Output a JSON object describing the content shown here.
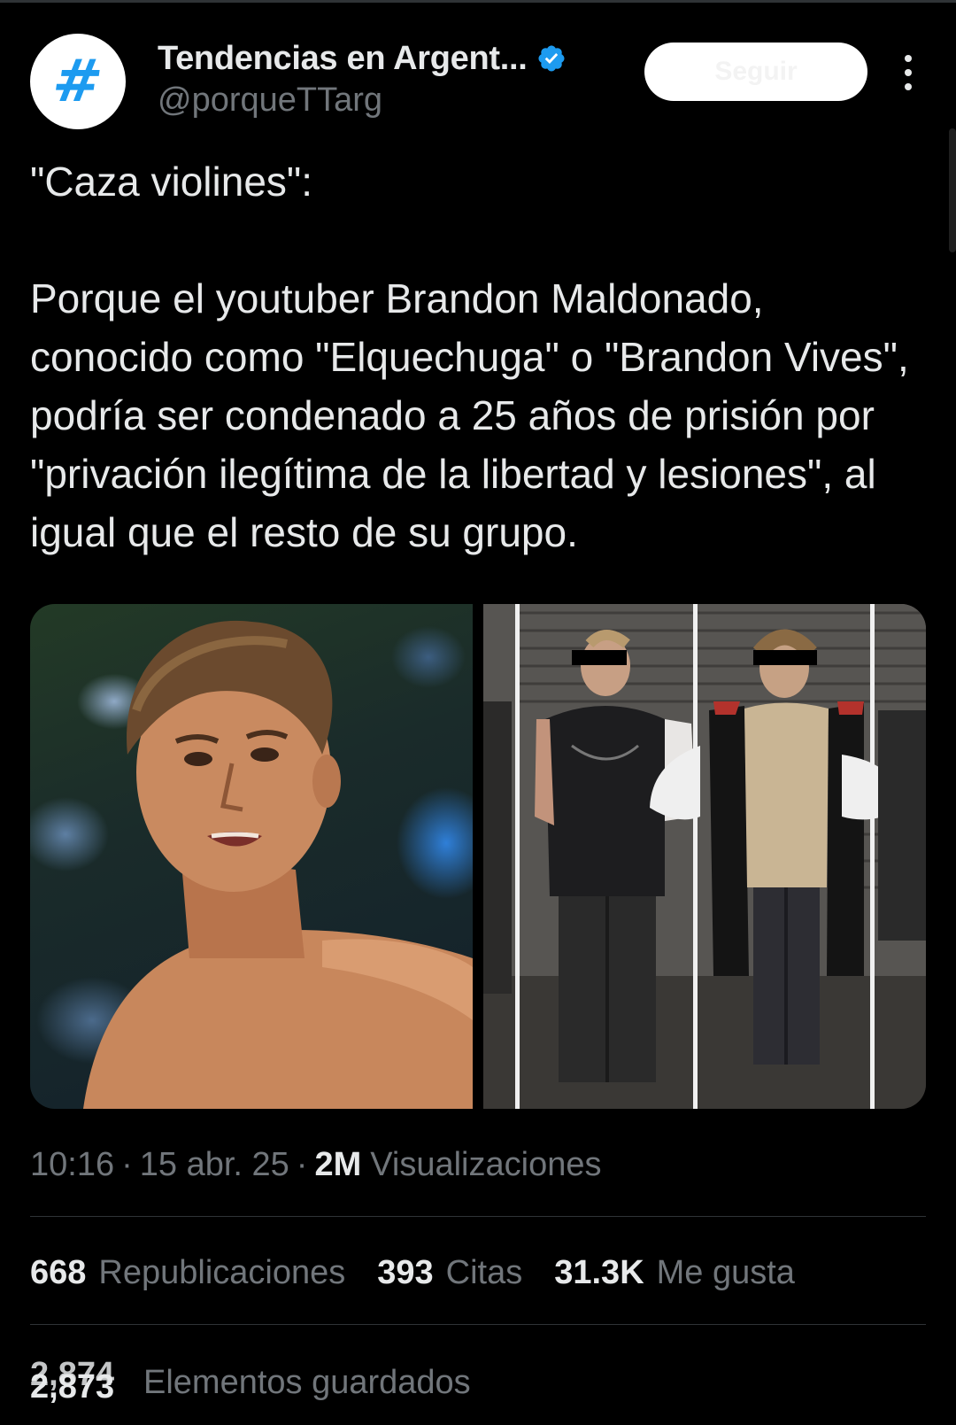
{
  "account": {
    "display_name": "Tendencias en Argent...",
    "handle": "@porqueTTarg",
    "avatar_glyph": "#",
    "verified_icon": "verified-badge-icon",
    "verified_color": "#1d9bf0"
  },
  "follow_button": {
    "label": "Seguir"
  },
  "more_icon": "more-options-icon",
  "tweet": {
    "heading": "\"Caza violines\":",
    "body": "Porque el youtuber Brandon Maldonado, conocido como \"Elquechuga\" o \"Brandon Vives\", podría ser condenado a 25 años de prisión por \"privación ilegítima de la libertad y lesiones\", al igual que el resto de su grupo."
  },
  "meta": {
    "time": "10:16",
    "date": "15 abr. 25",
    "views_count": "2M",
    "views_label": "Visualizaciones"
  },
  "stats": [
    {
      "count": "668",
      "label": "Republicaciones"
    },
    {
      "count": "393",
      "label": "Citas"
    },
    {
      "count": "31.3K",
      "label": "Me gusta"
    }
  ],
  "saved": {
    "count_previous": "2,874",
    "count_current": "2,873",
    "label": "Elementos guardados"
  },
  "colors": {
    "background": "#000000",
    "text_primary": "#e7e9ea",
    "text_secondary": "#71767b",
    "divider": "#2f3336",
    "accent": "#1d9bf0"
  }
}
